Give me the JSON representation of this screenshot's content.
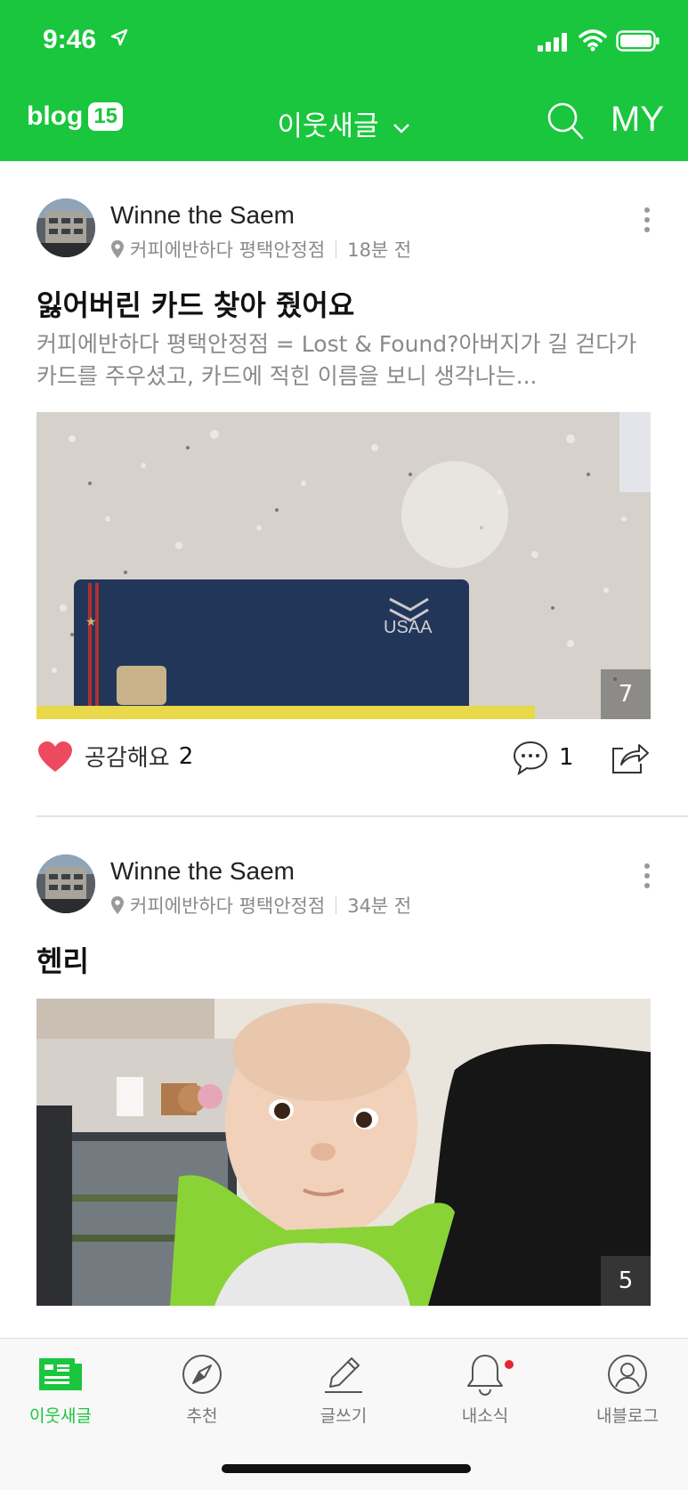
{
  "status_bar": {
    "time": "9:46"
  },
  "nav": {
    "logo_text": "blog",
    "logo_badge": "15",
    "title": "이웃새글",
    "my_label": "MY"
  },
  "posts": [
    {
      "author": "Winne the Saem",
      "location": "커피에반하다 평택안정점",
      "time_ago": "18분 전",
      "title": "잃어버린 카드 찾아 줬어요",
      "excerpt": "커피에반하다 평택안정점 = Lost & Found?아버지가 길 걷다가 카드를 주우셨고, 카드에 적힌 이름을 보니 생각나는...",
      "photo_count": "7",
      "card_brand": "USAA",
      "like_label": "공감해요",
      "like_count": "2",
      "comment_count": "1"
    },
    {
      "author": "Winne the Saem",
      "location": "커피에반하다 평택안정점",
      "time_ago": "34분 전",
      "title": "헨리",
      "photo_count": "5"
    }
  ],
  "tabs": [
    {
      "label": "이웃새글",
      "active": true
    },
    {
      "label": "추천"
    },
    {
      "label": "글쓰기"
    },
    {
      "label": "내소식",
      "has_badge": true
    },
    {
      "label": "내블로그"
    }
  ],
  "colors": {
    "brand_green": "#19c63d",
    "like_red": "#ee4a5f",
    "badge_red": "#e8262f"
  }
}
